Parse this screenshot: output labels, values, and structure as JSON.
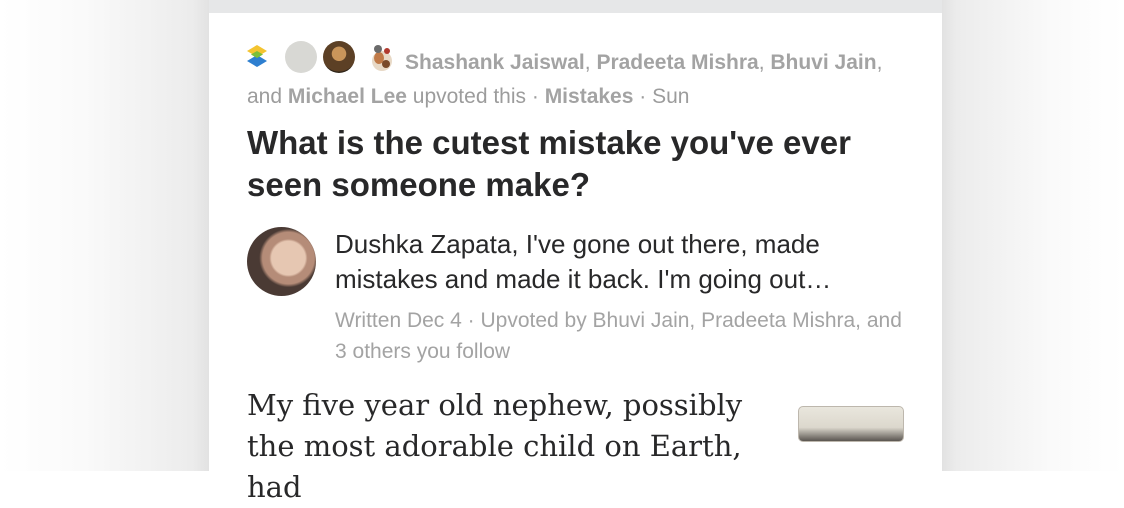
{
  "activity": {
    "name_1": "Shashank Jaiswal",
    "sep_1": ", ",
    "name_2": "Pradeeta Mishra",
    "sep_2": ", ",
    "name_3": "Bhuvi Jain",
    "sep_3": ", and ",
    "name_4": "Michael Lee",
    "action": " upvoted this · ",
    "space": "Mistakes",
    "time": " · Sun"
  },
  "question": {
    "title": "What is the cutest mistake you've ever seen someone make?"
  },
  "answer": {
    "author_line": "Dushka Zapata, I've gone out there, made mistakes and made it back. I'm going out…",
    "meta": "Written Dec 4 · Upvoted by Bhuvi Jain, Pradeeta Mishra, and 3 others you follow",
    "body": "My five year old nephew, possibly the most adorable child on Earth, had"
  },
  "icons": {
    "space": "space-logo-icon",
    "upvoter_1": "avatar-icon",
    "upvoter_2": "avatar-icon",
    "upvoter_3": "avatar-icon",
    "thumbnail": "image-thumbnail"
  },
  "colors": {
    "meta_text": "#a3a3a3",
    "title_text": "#282829",
    "space_blue": "#2e7fd0",
    "space_yellow": "#f4c430"
  }
}
